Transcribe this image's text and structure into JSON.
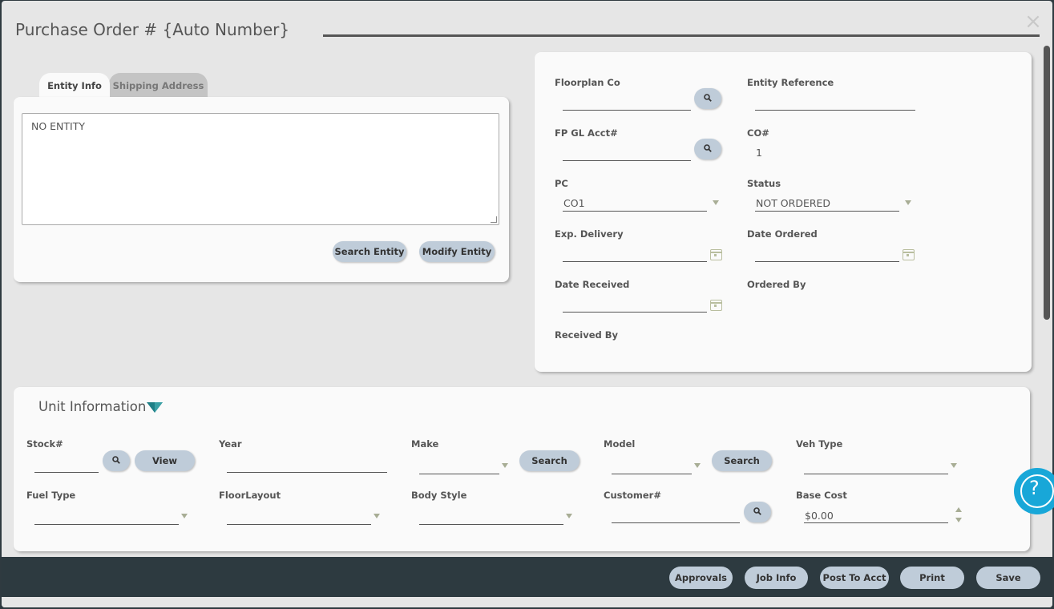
{
  "modal": {
    "title": "Purchase Order #  {Auto Number}",
    "close_label": "×"
  },
  "entity": {
    "tabs": [
      "Entity Info",
      "Shipping Address"
    ],
    "text": "NO ENTITY",
    "search_label": "Search Entity",
    "modify_label": "Modify Entity"
  },
  "details": {
    "floorplan_co": "Floorplan Co",
    "entity_reference": "Entity Reference",
    "fp_gl_acct": "FP GL Acct#",
    "co_num": "CO#",
    "co_num_value": "1",
    "pc": "PC",
    "pc_value": "CO1",
    "status": "Status",
    "status_value": "NOT ORDERED",
    "exp_delivery": "Exp. Delivery",
    "date_ordered": "Date Ordered",
    "date_received": "Date Received",
    "ordered_by": "Ordered By",
    "received_by": "Received By"
  },
  "unit": {
    "title": "Unit Information",
    "stock": "Stock#",
    "view_label": "View",
    "year": "Year",
    "make": "Make",
    "make_search": "Search",
    "model": "Model",
    "model_search": "Search",
    "veh_type": "Veh Type",
    "fuel_type": "Fuel Type",
    "floor_layout": "FloorLayout",
    "body_style": "Body Style",
    "customer": "Customer#",
    "base_cost": "Base Cost",
    "base_cost_value": "$0.00"
  },
  "help": {
    "glyph": "?"
  },
  "footer": {
    "approvals": "Approvals",
    "job_info": "Job Info",
    "post_to_acct": "Post To Acct",
    "print": "Print",
    "save": "Save"
  },
  "colors": {
    "pill": "#bfccd9",
    "footer": "#2d3a40",
    "help": "#18a7d8",
    "chevron": "#1f7f86"
  }
}
